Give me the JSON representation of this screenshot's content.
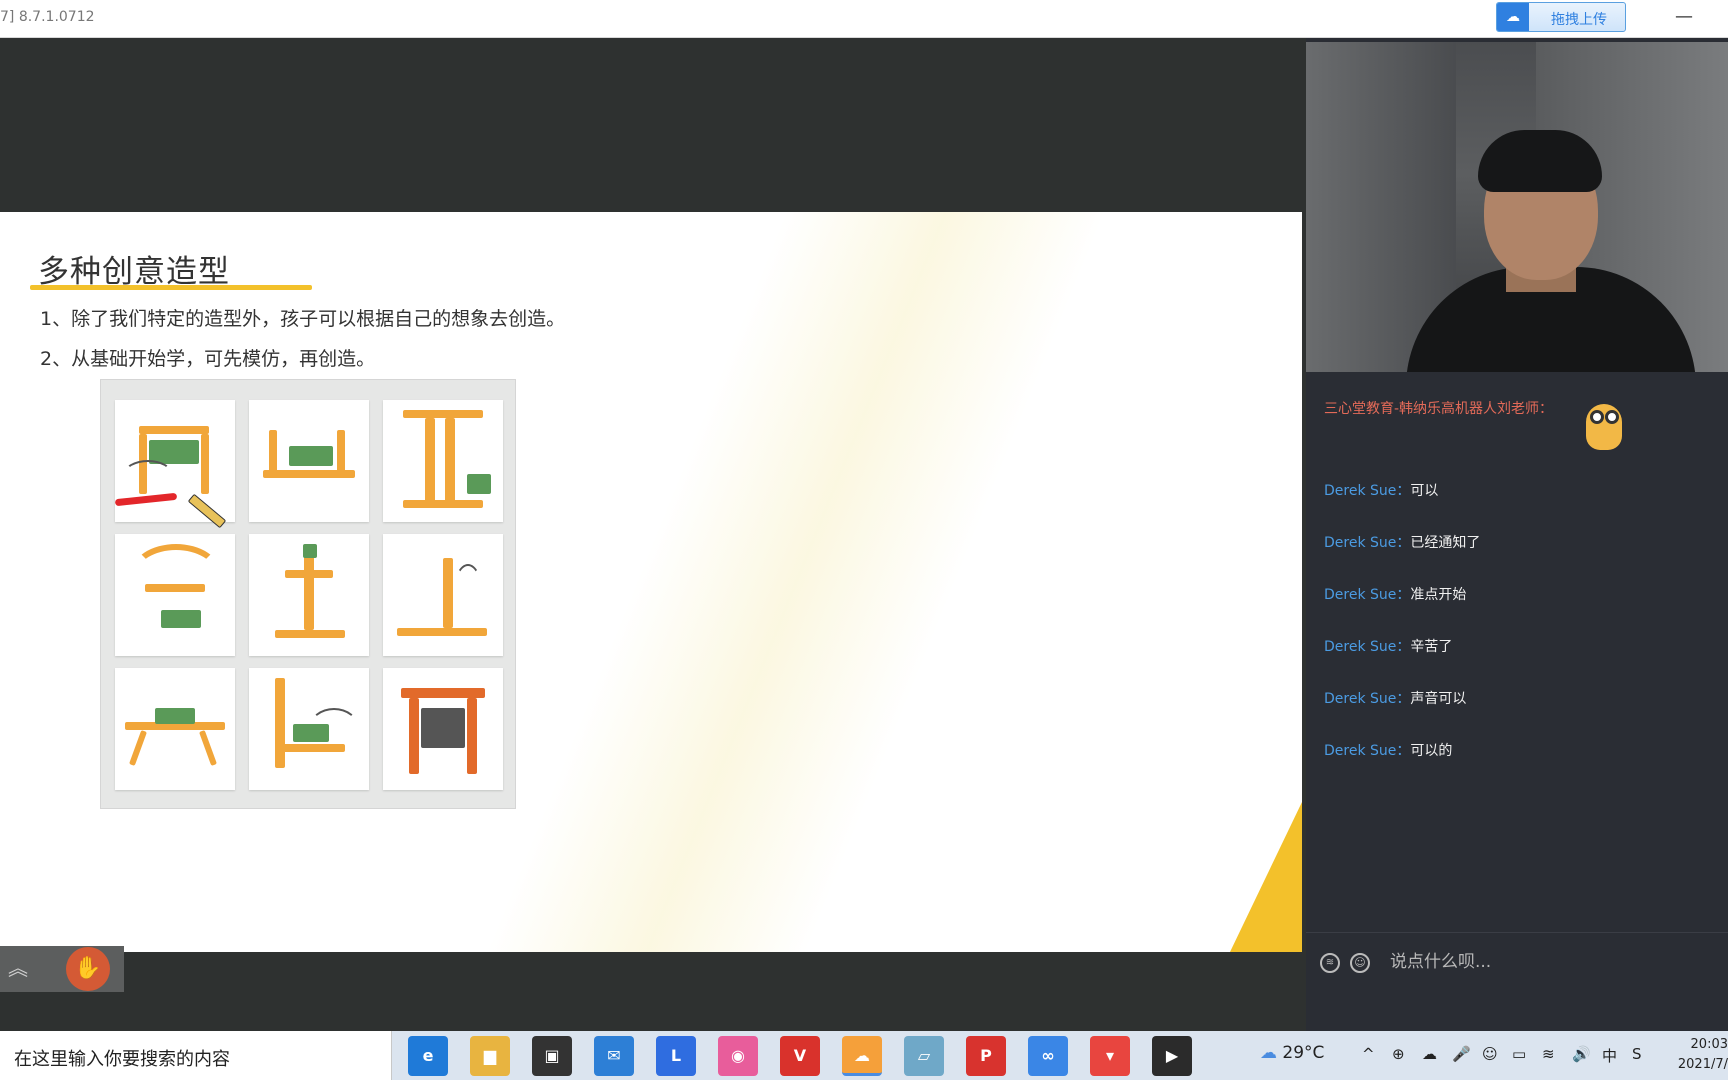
{
  "window": {
    "version": "7] 8.7.1.0712",
    "upload_label": "拖拽上传",
    "minimize_label": "—"
  },
  "slide": {
    "title": "多种创意造型",
    "bullets": [
      "1、除了我们特定的造型外，孩子可以根据自己的想象去创造。",
      "2、从基础开始学，可先模仿，再创造。"
    ]
  },
  "stage_tools": {
    "collapse_icon": "chevrons-up-icon",
    "raise_hand_icon": "hand-icon"
  },
  "chat": {
    "teacher": "三心堂教育-韩纳乐高机器人刘老师：",
    "messages": [
      {
        "sender": "Derek Sue：",
        "text": "可以"
      },
      {
        "sender": "Derek Sue：",
        "text": "已经通知了"
      },
      {
        "sender": "Derek Sue：",
        "text": "准点开始"
      },
      {
        "sender": "Derek Sue：",
        "text": "辛苦了"
      },
      {
        "sender": "Derek Sue：",
        "text": "声音可以"
      },
      {
        "sender": "Derek Sue：",
        "text": "可以的"
      }
    ],
    "input_placeholder": "说点什么呗..."
  },
  "taskbar": {
    "search_placeholder": "在这里输入你要搜索的内容",
    "apps": [
      {
        "name": "edge-icon",
        "color": "#1f7ad8",
        "glyph": "e"
      },
      {
        "name": "file-explorer-icon",
        "color": "#e8b440",
        "glyph": "▆"
      },
      {
        "name": "store-icon",
        "color": "#333333",
        "glyph": "▣"
      },
      {
        "name": "mail-icon",
        "color": "#2d7fd6",
        "glyph": "✉"
      },
      {
        "name": "l-app-icon",
        "color": "#2f6de0",
        "glyph": "L"
      },
      {
        "name": "color-wheel-icon",
        "color": "#e85d9b",
        "glyph": "◉"
      },
      {
        "name": "vector-app-icon",
        "color": "#d9322c",
        "glyph": "V"
      },
      {
        "name": "wechat-icon",
        "color": "#f5a03a",
        "glyph": "☁"
      },
      {
        "name": "notes-icon",
        "color": "#6fa8c8",
        "glyph": "▱"
      },
      {
        "name": "pdf-icon",
        "color": "#d8332e",
        "glyph": "P"
      },
      {
        "name": "baidu-netdisk-icon",
        "color": "#3a86e6",
        "glyph": "∞"
      },
      {
        "name": "pocket-icon",
        "color": "#e8453f",
        "glyph": "▾"
      },
      {
        "name": "video-app-icon",
        "color": "#2b2b2b",
        "glyph": "▶"
      }
    ],
    "weather": "29°C",
    "tray": [
      "^",
      "⊕",
      "☁",
      "🎤",
      "☺",
      "▭",
      "≋",
      "🔊",
      "中",
      "S"
    ],
    "time": "20:03",
    "date": "2021/7/"
  }
}
